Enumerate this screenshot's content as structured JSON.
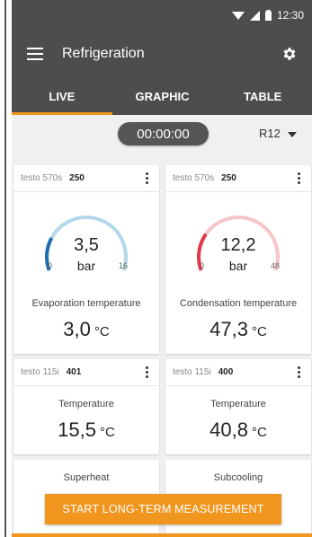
{
  "status": {
    "time": "12:30"
  },
  "app": {
    "title": "Refrigeration"
  },
  "tabs": [
    {
      "label": "LIVE",
      "active": true
    },
    {
      "label": "GRAPHIC",
      "active": false
    },
    {
      "label": "TABLE",
      "active": false
    }
  ],
  "timer": "00:00:00",
  "refrigerant": "R12",
  "cards": {
    "evap": {
      "device": "testo 570s",
      "serial": "250",
      "gauge_value": "3,5",
      "gauge_unit": "bar",
      "min": "0",
      "max": "16",
      "gauge_fraction": 0.22,
      "gauge_color": "#1e6fb0",
      "track_color": "#b3d8ea",
      "label": "Evaporation temperature",
      "value": "3,0",
      "unit": "°C"
    },
    "cond": {
      "device": "testo 570s",
      "serial": "250",
      "gauge_value": "12,2",
      "gauge_unit": "bar",
      "min": "0",
      "max": "48",
      "gauge_fraction": 0.25,
      "gauge_color": "#e03a4a",
      "track_color": "#f6c5c9",
      "label": "Condensation temperature",
      "value": "47,3",
      "unit": "°C"
    },
    "temp1": {
      "device": "testo 115i",
      "serial": "401",
      "label": "Temperature",
      "value": "15,5",
      "unit": "°C"
    },
    "temp2": {
      "device": "testo 115i",
      "serial": "400",
      "label": "Temperature",
      "value": "40,8",
      "unit": "°C"
    },
    "superheat": {
      "label": "Superheat"
    },
    "subcooling": {
      "label": "Subcooling"
    }
  },
  "start_button": "START LONG-TERM MEASUREMENT",
  "colors": {
    "accent": "#f0961e",
    "bar": "#4d4d4d"
  }
}
